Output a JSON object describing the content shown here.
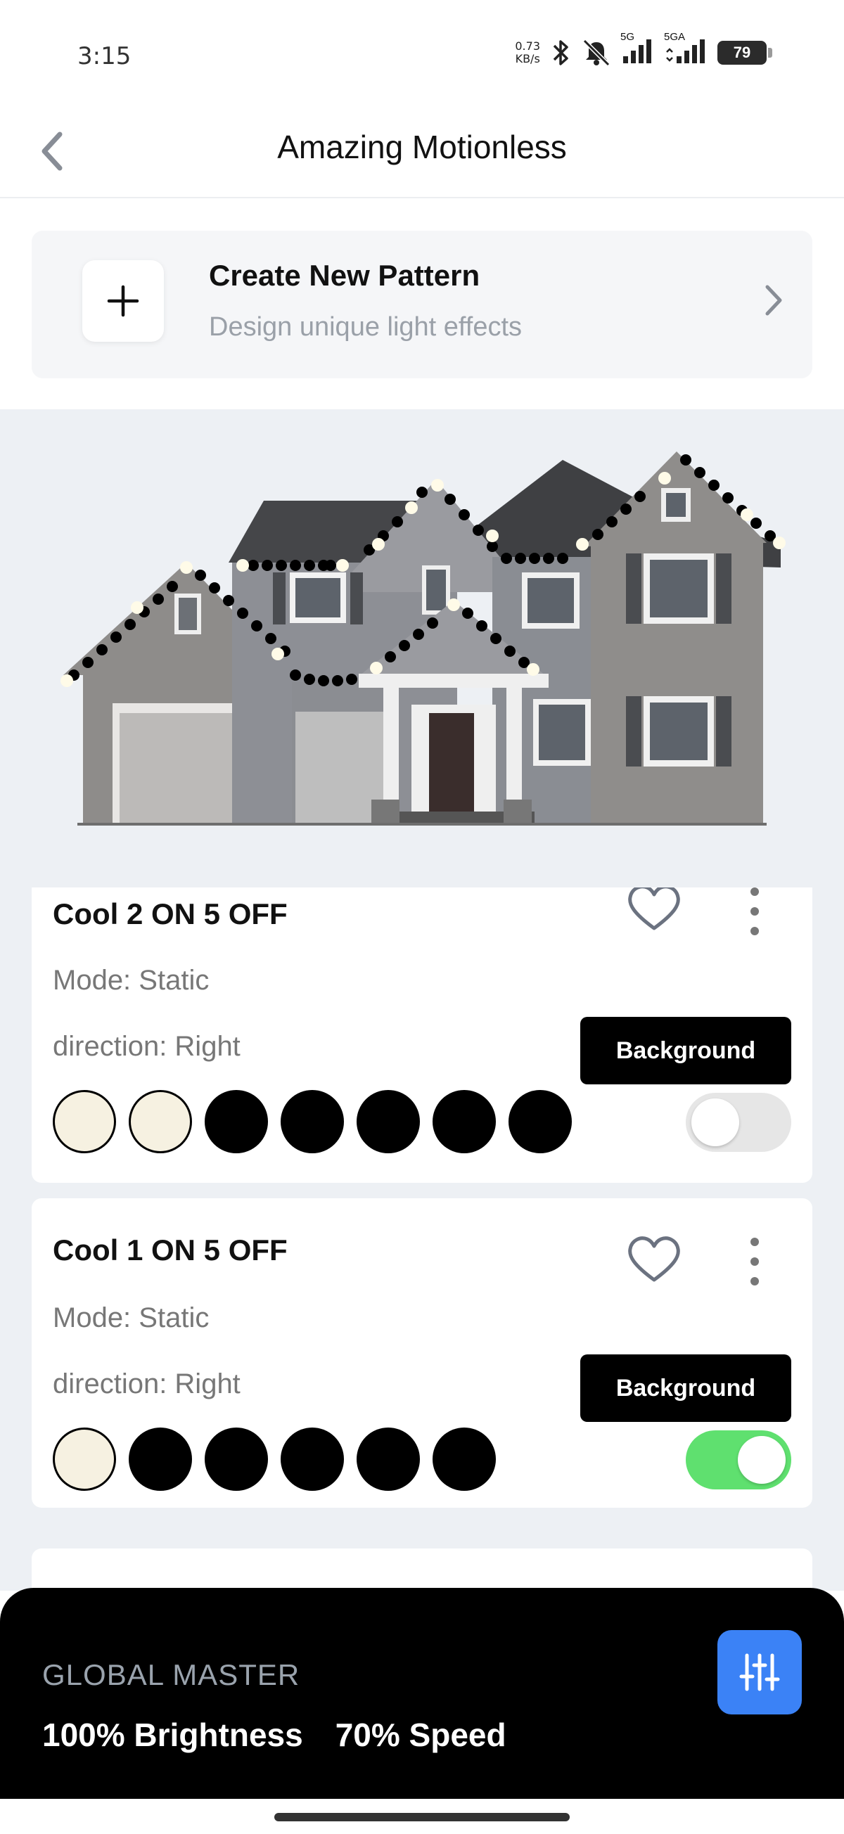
{
  "status": {
    "time": "3:15",
    "net_speed_value": "0.73",
    "net_speed_unit": "KB/s",
    "sig1_label": "5G",
    "sig2_label": "5GA",
    "battery": "79"
  },
  "header": {
    "title": "Amazing Motionless"
  },
  "create": {
    "title": "Create New Pattern",
    "subtitle": "Design unique light effects"
  },
  "patterns": [
    {
      "name": "Cool 2 ON 5 OFF",
      "mode": "Mode: Static",
      "direction": "direction: Right",
      "button": "Background",
      "enabled": false,
      "colors": [
        "cream",
        "cream",
        "black",
        "black",
        "black",
        "black",
        "black"
      ]
    },
    {
      "name": "Cool 1 ON 5 OFF",
      "mode": "Mode: Static",
      "direction": "direction: Right",
      "button": "Background",
      "enabled": true,
      "colors": [
        "cream",
        "black",
        "black",
        "black",
        "black",
        "black"
      ]
    }
  ],
  "master": {
    "label": "GLOBAL MASTER",
    "brightness": "100% Brightness",
    "speed": "70% Speed"
  },
  "colors": {
    "accent_blue": "#3b82f6",
    "toggle_on": "#5fe06f",
    "cream": "#f6f1e1"
  }
}
